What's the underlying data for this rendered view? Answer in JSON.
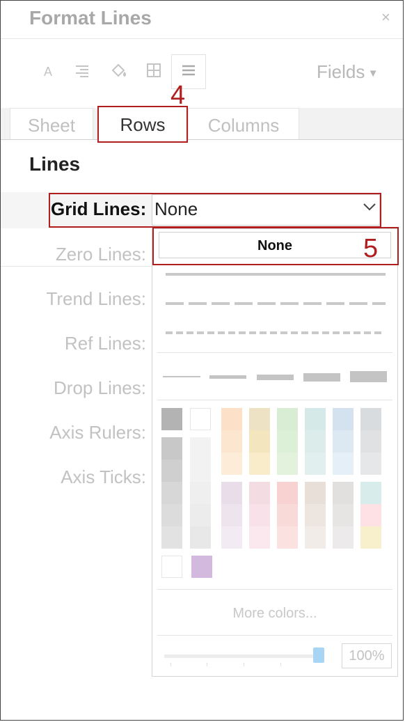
{
  "panel": {
    "title": "Format Lines",
    "close_glyph": "×"
  },
  "toolbar": {
    "icons": [
      "font-icon",
      "align-icon",
      "shading-icon",
      "borders-icon",
      "lines-icon"
    ],
    "fields_label": "Fields",
    "fields_arrow": "▾"
  },
  "tabs": [
    {
      "label": "Sheet"
    },
    {
      "label": "Rows",
      "selected": true
    },
    {
      "label": "Columns"
    }
  ],
  "annotations": {
    "step4": "4",
    "step5": "5"
  },
  "section": {
    "title": "Lines"
  },
  "grid_lines": {
    "label": "Grid Lines:",
    "value": "None"
  },
  "line_options": [
    {
      "label": "Zero Lines:"
    },
    {
      "label": "Trend Lines:"
    },
    {
      "label": "Ref Lines:"
    },
    {
      "label": "Drop Lines:"
    },
    {
      "label": "Axis Rulers:"
    },
    {
      "label": "Axis Ticks:"
    }
  ],
  "dropdown": {
    "none_option": "None",
    "line_styles": [
      "solid",
      "dashed",
      "dotted"
    ],
    "line_weights": [
      1,
      2,
      3,
      4,
      5
    ],
    "gray_swatches": [
      "#b3b3b3",
      "#c8c8c8",
      "#cfcfcf",
      "#d7d7d7",
      "#dcdcdc",
      "#e2e2e2"
    ],
    "light_gray_swatches": [
      "#ffffff",
      "#f2f2f2",
      "#f2f2f2",
      "#efefef",
      "#ececec",
      "#e8e8e8"
    ],
    "color_swatches_top": [
      [
        "#fde0c8",
        "#fde6cf",
        "#fdecd8"
      ],
      [
        "#eee2c4",
        "#f3e6bf",
        "#f8ecca"
      ],
      [
        "#d9edd5",
        "#dcefd7",
        "#e2f2dc"
      ],
      [
        "#d5eae8",
        "#dbecea",
        "#e1efee"
      ],
      [
        "#d4e1ef",
        "#dce8f2",
        "#e4eff8"
      ],
      [
        "#d9dcdf",
        "#dfe1e3",
        "#e5e7e8"
      ]
    ],
    "color_swatches_bottom": [
      [
        "#e9dde9",
        "#eee4ee",
        "#f3ebf3"
      ],
      [
        "#f4dce3",
        "#f8e1e8",
        "#fbe8ee"
      ],
      [
        "#f7d2d1",
        "#f8dad8",
        "#fbe1df"
      ],
      [
        "#e8dfd9",
        "#ede5e0",
        "#f2ece8"
      ],
      [
        "#e2e0df",
        "#e7e5e4",
        "#eceaea"
      ],
      [
        "#d9ecec",
        "#fde1e4",
        "#f8efcc"
      ]
    ],
    "extra_swatches": [
      "#ffffff",
      "#d3b9dd"
    ],
    "more_colors_label": "More colors...",
    "opacity_value": "100%",
    "opacity_level": 1.0
  }
}
